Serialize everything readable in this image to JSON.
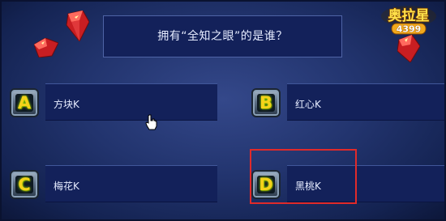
{
  "question": {
    "text": "拥有“全知之眼”的是谁？"
  },
  "answers": [
    {
      "letter": "A",
      "text": "方块K"
    },
    {
      "letter": "B",
      "text": "红心K"
    },
    {
      "letter": "C",
      "text": "梅花K"
    },
    {
      "letter": "D",
      "text": "黑桃K"
    }
  ],
  "logo": {
    "text_top": "奥拉星",
    "text_bottom": "4399"
  },
  "highlighted_answer": "D",
  "colors": {
    "background": "#22346e",
    "panel": "#13215a",
    "letter": "#f4d21a",
    "highlight": "#e02a2a",
    "gem": "#d8282a"
  },
  "icons": {
    "gem": "red-gem-icon",
    "cursor": "hand-cursor-icon"
  }
}
